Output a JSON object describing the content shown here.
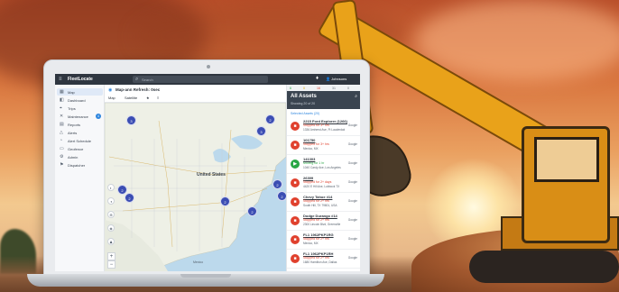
{
  "colors": {
    "topbar": "#2f3640",
    "accent": "#2e86de",
    "cluster": "#3b4db3",
    "moving": "#28a745",
    "stopped": "#e0412e",
    "excavator": "#e9a21a"
  },
  "app": {
    "logo": "FleetLocate",
    "search_placeholder": "Search",
    "user_label": "Johnsons"
  },
  "sidebar": {
    "items": [
      {
        "label": "Map",
        "icon": "map-icon",
        "active": true
      },
      {
        "label": "Dashboard",
        "icon": "dashboard-icon"
      },
      {
        "label": "Trips",
        "icon": "trips-icon"
      },
      {
        "label": "Maintenance",
        "icon": "wrench-icon",
        "badge": "4"
      },
      {
        "label": "Reports",
        "icon": "reports-icon"
      },
      {
        "label": "Alerts",
        "icon": "bell-icon"
      },
      {
        "label": "Alert Schedule",
        "icon": "schedule-icon"
      },
      {
        "label": "Geofence",
        "icon": "geofence-icon"
      },
      {
        "label": "Admin",
        "icon": "gear-icon"
      },
      {
        "label": "Dispatcher",
        "icon": "dispatch-icon"
      }
    ]
  },
  "map": {
    "title": "Map-ann Refresh: 0sec",
    "tabs": [
      "Map",
      "Satellite",
      "★",
      "≡"
    ],
    "country_label": "United States",
    "labels": [
      "Mexico"
    ],
    "clusters": [
      "3",
      "2",
      "2",
      "2",
      "2",
      "3",
      "2",
      "2",
      "2"
    ]
  },
  "assets": {
    "status_counts": [
      "6",
      "0",
      "16",
      "31",
      "0"
    ],
    "title": "All Assets",
    "subtitle": "Showing 20 of 20",
    "section": "Selected Assets (20)",
    "items": [
      {
        "name": "2215 Ford Explorer (1266)",
        "status": "Stopped for 3+ hrs",
        "state": "stopped",
        "location": "1336 Amherst Ave, Ft Lauderdale",
        "side": "Google"
      },
      {
        "name": "101750",
        "status": "Stopped for 3+ hrs",
        "state": "stopped",
        "location": "Mexico, MX",
        "side": "Google"
      },
      {
        "name": "141303",
        "status": "Moving for 1 hr",
        "state": "moving",
        "location": "1040 Cardy Ave, Los Angeles",
        "side": "Google"
      },
      {
        "name": "26399",
        "status": "Stopped for 2+ days",
        "state": "stopped",
        "location": "4420 E Hill Ave, Lubbock TX",
        "side": "Google"
      },
      {
        "name": "Chevy Tahoe #14",
        "status": "Stopped for 2+ hrs",
        "state": "stopped",
        "location": "South Hill, TX 79801, USA",
        "side": "Google"
      },
      {
        "name": "Dodge Durango #14",
        "status": "Stopped for 2+ hrs",
        "state": "stopped",
        "location": "2300 Lincoln Blvd, Greenville",
        "side": "Google"
      },
      {
        "name": "FL1 1962PKP1RG",
        "status": "Stopped for 2+ hrs",
        "state": "stopped",
        "location": "Mexico, MX",
        "side": "Google"
      },
      {
        "name": "FL1 1962PKP1RH",
        "status": "Stopped for 2+ hrs",
        "state": "stopped",
        "location": "1680 Hamilton Ave, Dallas",
        "side": "Google"
      }
    ]
  }
}
